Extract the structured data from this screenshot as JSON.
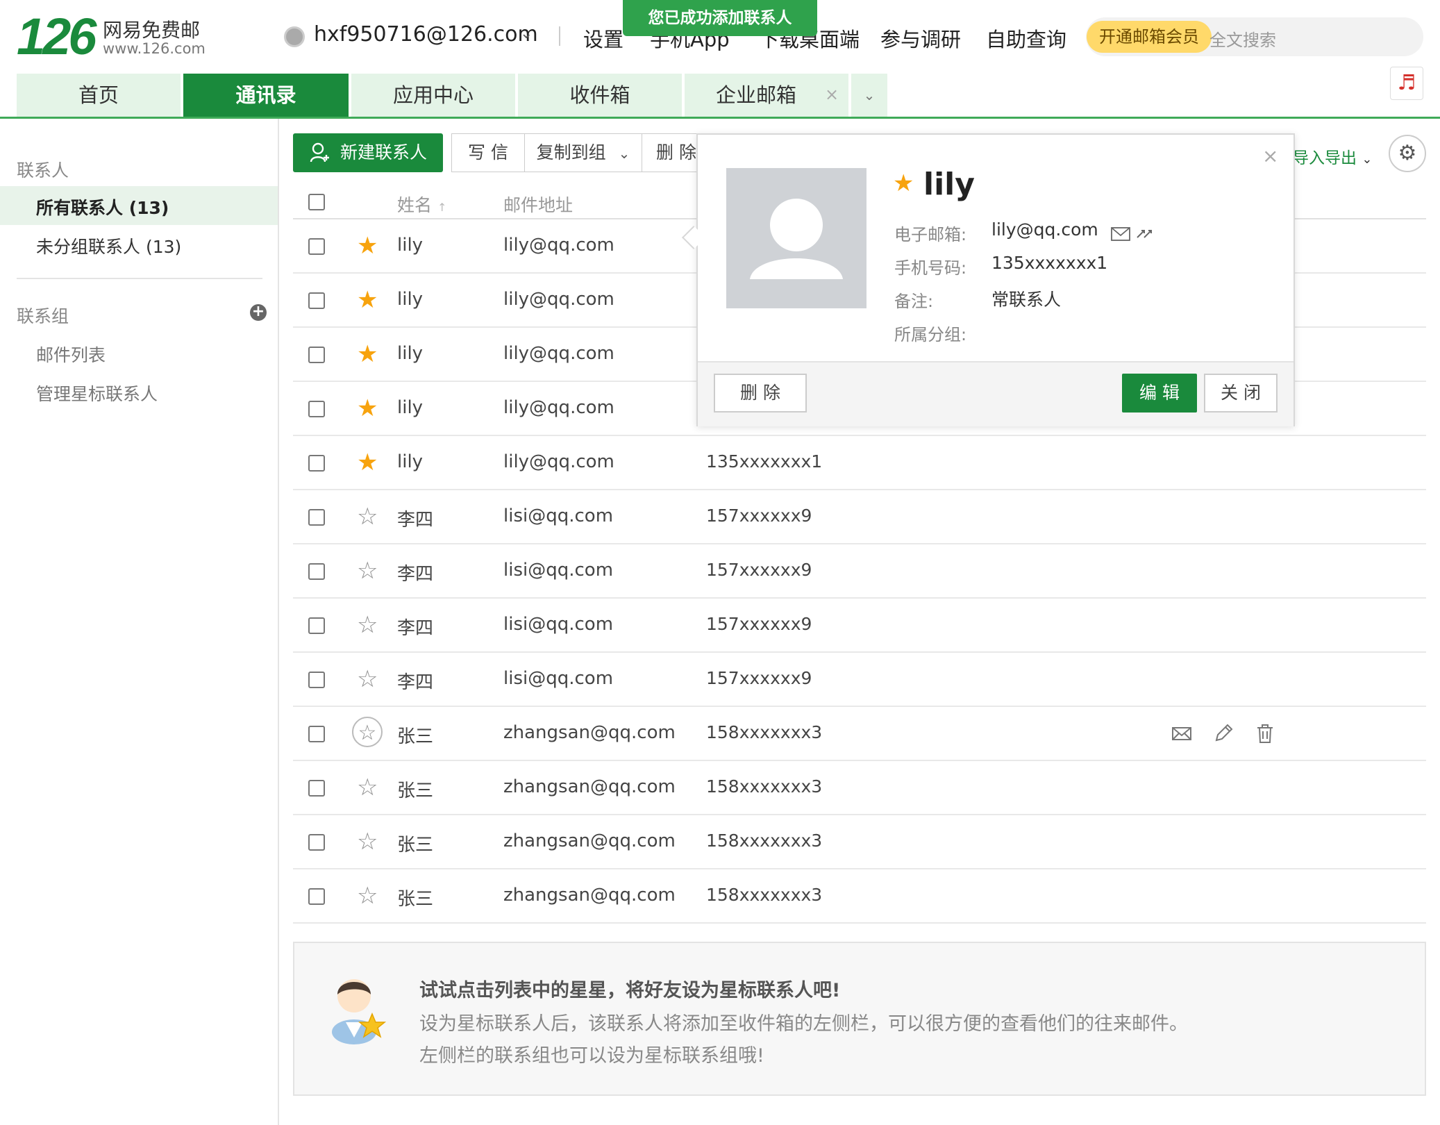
{
  "logo": {
    "number": "126",
    "name": "网易免费邮",
    "url": "www.126.com"
  },
  "account": {
    "email": "hxf950716@126.com",
    "caret": "⌄"
  },
  "top_nav": [
    "设置",
    "手机App",
    "下载桌面端",
    "参与调研",
    "自助查询"
  ],
  "toast": "您已成功添加联系人",
  "vip_label": "开通邮箱会员",
  "search_placeholder": "全文搜索",
  "tabs": [
    {
      "label": "首页"
    },
    {
      "label": "通讯录",
      "active": true
    },
    {
      "label": "应用中心"
    },
    {
      "label": "收件箱"
    },
    {
      "label": "企业邮箱"
    }
  ],
  "tab_close": "×",
  "sidebar": {
    "contacts_title": "联系人",
    "all_contacts": "所有联系人 (13)",
    "ungrouped": "未分组联系人 (13)",
    "groups_title": "联系组",
    "add_group": "+",
    "mail_list": "邮件列表",
    "manage_starred": "管理星标联系人"
  },
  "toolbar": {
    "new_contact": "新建联系人",
    "write": "写 信",
    "copy_to_group": "复制到组",
    "delete": "删 除",
    "import_export": "导入导出"
  },
  "table": {
    "col_name": "姓名",
    "col_email": "邮件地址",
    "rows": [
      {
        "starred": true,
        "name": "lily",
        "email": "lily@qq.com",
        "phone": ""
      },
      {
        "starred": true,
        "name": "lily",
        "email": "lily@qq.com",
        "phone": ""
      },
      {
        "starred": true,
        "name": "lily",
        "email": "lily@qq.com",
        "phone": ""
      },
      {
        "starred": true,
        "name": "lily",
        "email": "lily@qq.com",
        "phone": ""
      },
      {
        "starred": true,
        "name": "lily",
        "email": "lily@qq.com",
        "phone": "135xxxxxxx1"
      },
      {
        "starred": false,
        "name": "李四",
        "email": "lisi@qq.com",
        "phone": "157xxxxxx9"
      },
      {
        "starred": false,
        "name": "李四",
        "email": "lisi@qq.com",
        "phone": "157xxxxxx9"
      },
      {
        "starred": false,
        "name": "李四",
        "email": "lisi@qq.com",
        "phone": "157xxxxxx9"
      },
      {
        "starred": false,
        "name": "李四",
        "email": "lisi@qq.com",
        "phone": "157xxxxxx9"
      },
      {
        "starred": false,
        "name": "张三",
        "email": "zhangsan@qq.com",
        "phone": "158xxxxxxx3",
        "hovered": true
      },
      {
        "starred": false,
        "name": "张三",
        "email": "zhangsan@qq.com",
        "phone": "158xxxxxxx3"
      },
      {
        "starred": false,
        "name": "张三",
        "email": "zhangsan@qq.com",
        "phone": "158xxxxxxx3"
      },
      {
        "starred": false,
        "name": "张三",
        "email": "zhangsan@qq.com",
        "phone": "158xxxxxxx3"
      }
    ]
  },
  "tip": {
    "title": "试试点击列表中的星星，将好友设为星标联系人吧!",
    "line1": "设为星标联系人后，该联系人将添加至收件箱的左侧栏，可以很方便的查看他们的往来邮件。",
    "line2": "左侧栏的联系组也可以设为星标联系组哦!"
  },
  "card": {
    "name": "lily",
    "email_label": "电子邮箱:",
    "email": "lily@qq.com",
    "phone_label": "手机号码:",
    "phone": "135xxxxxxx1",
    "note_label": "备注:",
    "note": "常联系人",
    "group_label": "所属分组:",
    "delete": "删 除",
    "edit": "编 辑",
    "close": "关 闭",
    "close_x": "×"
  },
  "colors": {
    "brand_green": "#1a8a3c",
    "star": "#f7a30e",
    "tab_bg": "#e4f4e7",
    "vip": "#ffd96a"
  }
}
